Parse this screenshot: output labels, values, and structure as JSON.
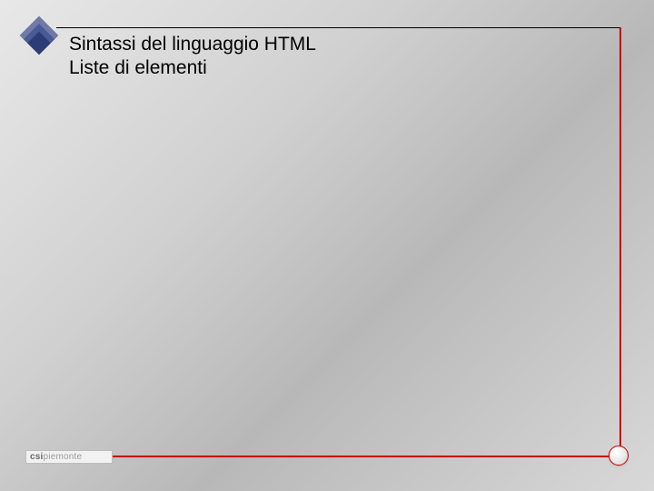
{
  "title": {
    "line1": "Sintassi del linguaggio HTML",
    "line2": "Liste di elementi"
  },
  "footer": {
    "brand_bold": "csi",
    "brand_rest": "piemonte"
  },
  "colors": {
    "accent": "#c60000",
    "logo_blue": "#2b3d74"
  }
}
